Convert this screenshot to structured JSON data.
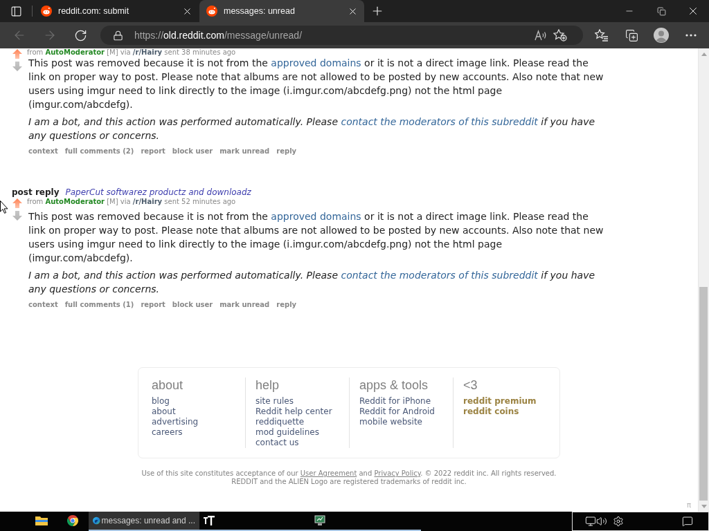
{
  "browser": {
    "tabs": [
      {
        "title": "reddit.com: submit",
        "selected": false
      },
      {
        "title": "messages: unread",
        "selected": true
      }
    ],
    "back": {
      "disabled": true
    },
    "forward": {
      "disabled": true
    },
    "address": {
      "scheme": "https://",
      "host": "old.reddit.com",
      "path": "/message/unread/"
    }
  },
  "messages": [
    {
      "from": "from",
      "author": "AutoModerator",
      "author_tag": "[M]",
      "via": "via",
      "subreddit": "/r/Hairy",
      "sent": "sent 38 minutes ago",
      "upvoted": true,
      "body": [
        {
          "kind": "text",
          "text": "This post was removed because it is not from the "
        },
        {
          "kind": "link",
          "text": "approved domains"
        },
        {
          "kind": "text",
          "text": " or it is not a direct image link. Please read the link on proper way to post. Please note that albums are not allowed to be posted by new accounts. Also note that new users using imgur need to link directly to the image (i.imgur.com/abcdefg.png) not the html page (imgur.com/abcdefg)."
        }
      ],
      "note": [
        {
          "kind": "text",
          "text": "I am a bot, and this action was performed automatically. Please "
        },
        {
          "kind": "link",
          "text": "contact the moderators of this subreddit"
        },
        {
          "kind": "text",
          "text": " if you have any questions or concerns."
        }
      ],
      "actions": [
        "context",
        "full comments (2)",
        "report",
        "block user",
        "mark unread",
        "reply"
      ]
    },
    {
      "title": "post reply",
      "subject": "PaperCut softwarez productz and downloadz",
      "from": "from",
      "author": "AutoModerator",
      "author_tag": "[M]",
      "via": "via",
      "subreddit": "/r/Hairy",
      "sent": "sent 52 minutes ago",
      "upvoted": true,
      "body": [
        {
          "kind": "text",
          "text": "This post was removed because it is not from the "
        },
        {
          "kind": "link",
          "text": "approved domains"
        },
        {
          "kind": "text",
          "text": " or it is not a direct image link. Please read the link on proper way to post. Please note that albums are not allowed to be posted by new accounts. Also note that new users using imgur need to link directly to the image (i.imgur.com/abcdefg.png) not the html page (imgur.com/abcdefg)."
        }
      ],
      "note": [
        {
          "kind": "text",
          "text": "I am a bot, and this action was performed automatically. Please "
        },
        {
          "kind": "link",
          "text": "contact the moderators of this subreddit"
        },
        {
          "kind": "text",
          "text": " if you have any questions or concerns."
        }
      ],
      "actions": [
        "context",
        "full comments (1)",
        "report",
        "block user",
        "mark unread",
        "reply"
      ]
    }
  ],
  "footer": {
    "columns": [
      {
        "title": "about",
        "kind": "regular",
        "links": [
          "blog",
          "about",
          "advertising",
          "careers"
        ]
      },
      {
        "title": "help",
        "kind": "regular",
        "links": [
          "site rules",
          "Reddit help center",
          "reddiquette",
          "mod guidelines",
          "contact us"
        ]
      },
      {
        "title": "apps & tools",
        "kind": "regular",
        "links": [
          "Reddit for iPhone",
          "Reddit for Android",
          "mobile website"
        ]
      },
      {
        "title": "<3",
        "kind": "featured",
        "links": [
          "reddit premium",
          "reddit coins"
        ]
      }
    ],
    "legal": [
      [
        {
          "kind": "text",
          "text": "Use of this site constitutes acceptance of our "
        },
        {
          "kind": "link",
          "text": "User Agreement"
        },
        {
          "kind": "text",
          "text": " and "
        },
        {
          "kind": "link",
          "text": "Privacy Policy"
        },
        {
          "kind": "text",
          "text": ". © 2022 reddit inc. All rights reserved."
        }
      ],
      [
        {
          "kind": "text",
          "text": "REDDIT and the ALIEN Logo are registered trademarks of reddit inc."
        }
      ]
    ]
  },
  "pi": "π",
  "taskbar": {
    "apps": [
      {
        "running": false,
        "selected": false
      },
      {
        "running": false,
        "selected": false
      },
      {
        "label": "messages: unread and ...",
        "running": true,
        "selected": true
      },
      {
        "running": true,
        "selected": false
      },
      {
        "running": true,
        "selected": false
      }
    ]
  }
}
